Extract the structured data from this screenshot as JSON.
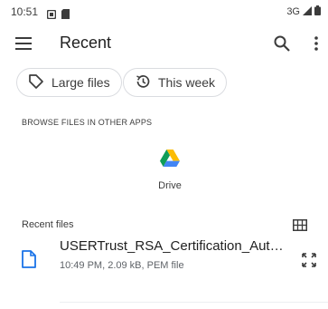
{
  "status_bar": {
    "time": "10:51",
    "left_icons": [
      "notification-square-icon",
      "sd-card-icon"
    ],
    "network": "3G",
    "right_icons": [
      "signal-icon",
      "battery-icon"
    ]
  },
  "app_bar": {
    "title": "Recent",
    "menu_icon": "hamburger-menu-icon",
    "search_icon": "search-icon",
    "more_icon": "more-vert-icon"
  },
  "chips": [
    {
      "label": "Large files",
      "icon": "label-tag-icon"
    },
    {
      "label": "This week",
      "icon": "history-icon"
    }
  ],
  "browse_section": {
    "heading": "BROWSE FILES IN OTHER APPS",
    "apps": [
      {
        "label": "Drive",
        "icon": "google-drive-icon"
      }
    ]
  },
  "recent_files": {
    "heading": "Recent files",
    "view_toggle_icon": "grid-view-icon",
    "items": [
      {
        "name": "USERTrust_RSA_Certification_Aut…",
        "meta": "10:49 PM, 2.09 kB, PEM file",
        "icon": "document-icon",
        "action_icon": "expand-icon"
      }
    ]
  },
  "colors": {
    "accent_icon": "#1a73e8",
    "text_primary": "#1f1f1f",
    "text_secondary": "#5f6368",
    "chip_border": "#dadce0"
  }
}
